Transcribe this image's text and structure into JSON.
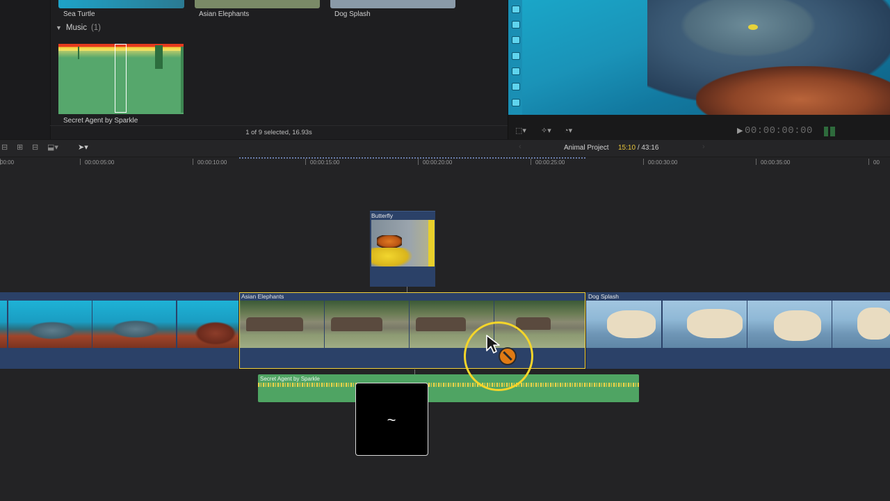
{
  "browser": {
    "clips": [
      {
        "label": "Sea Turtle"
      },
      {
        "label": "Asian Elephants"
      },
      {
        "label": "Dog Splash"
      }
    ],
    "music_section": {
      "label": "Music",
      "count": "(1)"
    },
    "music_clip_label": "Secret Agent by Sparkle",
    "status": "1 of 9 selected, 16.93s"
  },
  "viewer": {
    "timecode": "00:00:00:00"
  },
  "timeline": {
    "project_name": "Animal Project",
    "current_time": "15:10",
    "total_time": "/ 43:16",
    "ruler_labels": [
      "00:00",
      "00:00:05:00",
      "00:00:10:00",
      "00:00:15:00",
      "00:00:20:00",
      "00:00:25:00",
      "00:00:30:00",
      "00:00:35:00",
      "00"
    ],
    "clips": {
      "connected": "Butterfly",
      "primary_selected": "Asian Elephants",
      "primary_right": "Dog Splash",
      "audio": "Secret Agent by Sparkle"
    }
  },
  "drag_preview": {
    "glyph": "~"
  },
  "colors": {
    "selection": "#f3d13b",
    "video_clip": "#2b4168",
    "audio_clip": "#4fa463",
    "timecode_current": "#e8c53a"
  },
  "icons": [
    "play-icon",
    "transform-icon",
    "enhance-icon",
    "speed-icon",
    "select-tool-icon",
    "no-entry-icon",
    "arrow-cursor-icon"
  ]
}
